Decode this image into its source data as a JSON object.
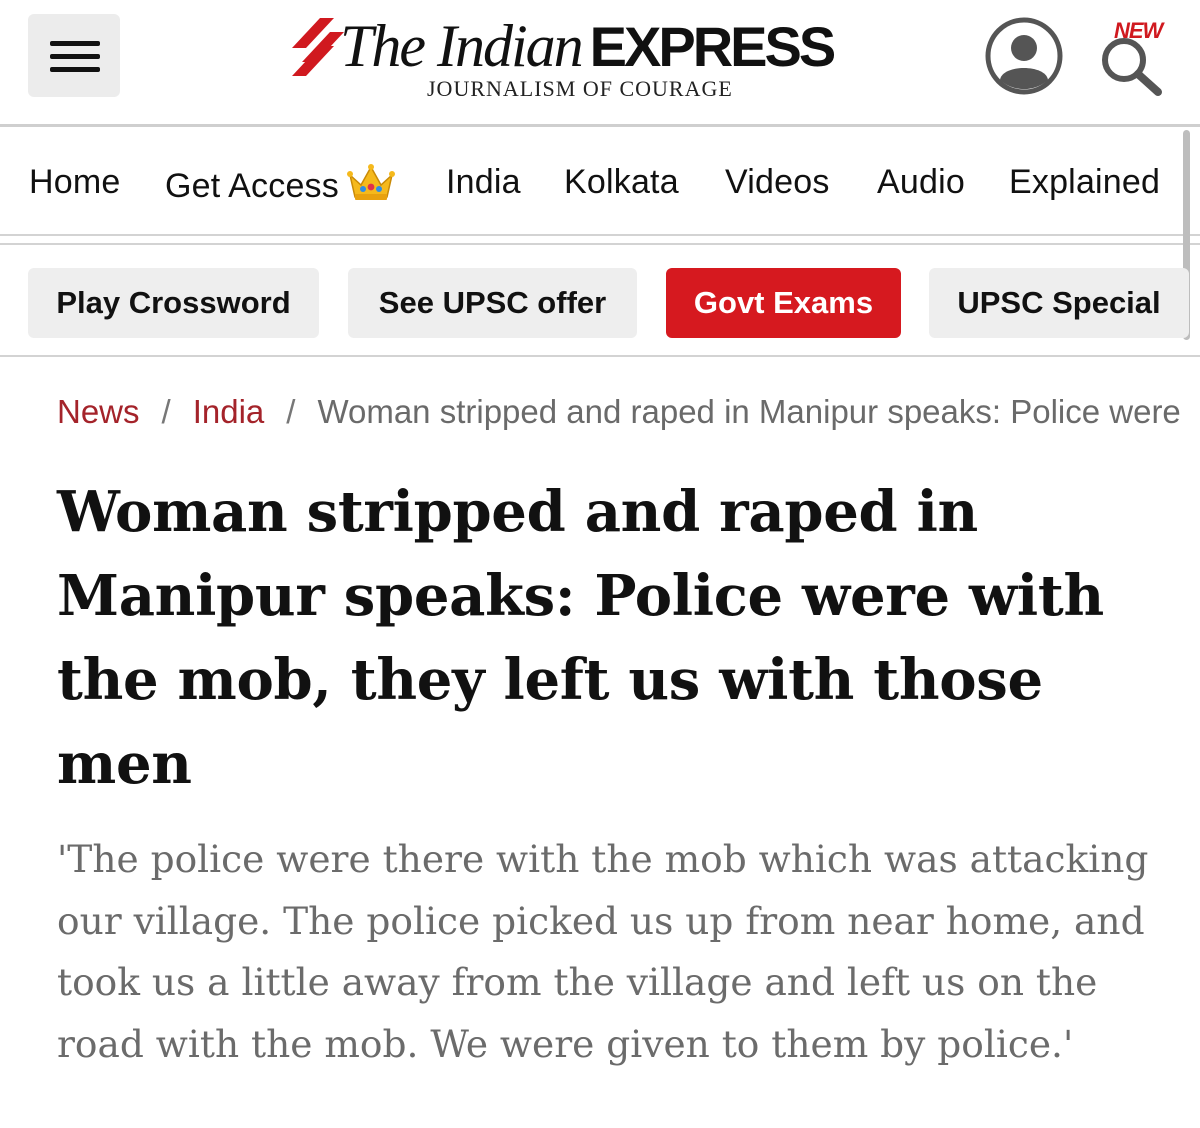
{
  "header": {
    "logo_prefix": "The Indian",
    "logo_suffix": "EXPRESS",
    "tagline": "JOURNALISM OF COURAGE",
    "new_badge": "NEW",
    "brand_color": "#d0191f"
  },
  "nav": {
    "items": [
      "Home",
      "Get Access",
      "India",
      "Kolkata",
      "Videos",
      "Audio",
      "Explained"
    ]
  },
  "chips": [
    "Play Crossword",
    "See UPSC offer",
    "Govt Exams",
    "UPSC Special"
  ],
  "breadcrumb": {
    "items": [
      "News",
      "India"
    ],
    "current": "Woman stripped and raped in Manipur speaks: Police were with the mob, they left us with those men"
  },
  "article": {
    "headline": "Woman stripped and raped in Manipur speaks: Police were with the mob, they left us with those men",
    "standfirst": "'The police were there with the mob which was attacking our village. The police picked us up from near home, and took us a little away from the village and left us on the road with the mob. We were given to them by police.'"
  },
  "colors": {
    "accent_red": "#d6191f",
    "breadcrumb_link": "#a4232a",
    "chip_bg": "#eeeeee"
  }
}
